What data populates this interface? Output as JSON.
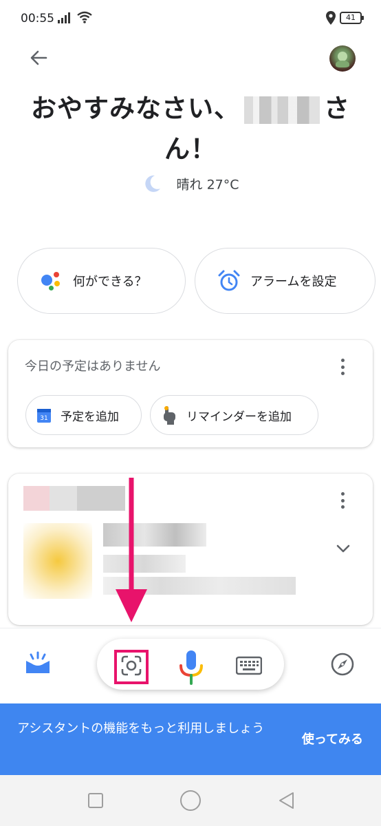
{
  "status_bar": {
    "time": "00:55",
    "battery": "41"
  },
  "header": {
    "back_icon": "arrow-back-icon",
    "avatar": "user-avatar"
  },
  "greeting": {
    "text_before": "おやすみなさい、",
    "text_after": "さん！"
  },
  "weather": {
    "icon": "moon-icon",
    "text": "晴れ 27°C"
  },
  "suggestions": [
    {
      "label": "何ができる？",
      "icon": "assistant-icon"
    },
    {
      "label": "アラームを設定",
      "icon": "alarm-icon"
    }
  ],
  "schedule_card": {
    "title": "今日の予定はありません",
    "actions": [
      {
        "label": "予定を追加",
        "icon": "calendar-icon"
      },
      {
        "label": "リマインダーを追加",
        "icon": "reminder-hand-icon"
      }
    ]
  },
  "bottom_bar": {
    "icons": [
      "updates-icon",
      "lens-icon",
      "mic-icon",
      "keyboard-icon",
      "explore-icon"
    ]
  },
  "promo": {
    "text": "アシスタントの機能をもっと利用しましょう",
    "action": "使ってみる"
  },
  "colors": {
    "google_blue": "#4285f4",
    "google_red": "#ea4335",
    "google_yellow": "#fbbc05",
    "google_green": "#34a853",
    "promo_bg": "#3f86f0",
    "annotation": "#e8136b"
  }
}
